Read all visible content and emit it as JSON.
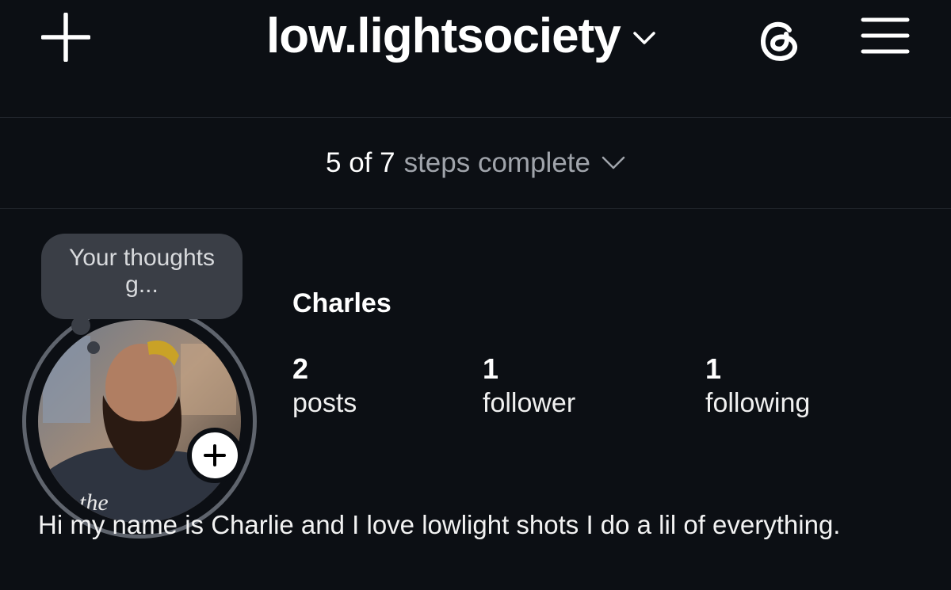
{
  "header": {
    "username": "low.lightsociety",
    "icons": [
      "plus-icon",
      "chevron-down-icon",
      "threads-icon",
      "hamburger-menu-icon"
    ]
  },
  "progress": {
    "count": "5 of 7",
    "label": "steps complete"
  },
  "profile": {
    "note": "Your thoughts g...",
    "name": "Charles",
    "stats": [
      {
        "value": "2",
        "label": "posts"
      },
      {
        "value": "1",
        "label": "follower"
      },
      {
        "value": "1",
        "label": "following"
      }
    ],
    "bio": "Hi my name is Charlie and I love lowlight shots I do a lil of everything.",
    "photo_shirt_text": "the"
  },
  "colors": {
    "background": "#0c0f14",
    "text": "#ffffff",
    "muted": "#a0a4ab",
    "bubble": "#3a3e46",
    "ring": "#5f646d"
  }
}
